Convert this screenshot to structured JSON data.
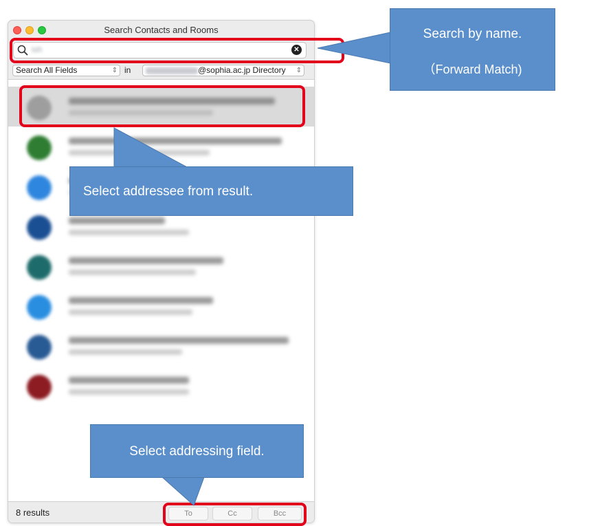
{
  "window": {
    "title": "Search Contacts and Rooms"
  },
  "search": {
    "value": "ish"
  },
  "filters": {
    "field_select": "Search All Fields",
    "in_label": "in",
    "directory_select_suffix": "@sophia.ac.jp Directory"
  },
  "results": {
    "avatar_colors": [
      "#9e9e9e",
      "#2e7d32",
      "#2e86de",
      "#1a4f93",
      "#1e6b6b",
      "#2a8ee0",
      "#285a94",
      "#8c1b22"
    ],
    "selected_index": 0
  },
  "status": {
    "count": "8 results",
    "to_label": "To",
    "cc_label": "Cc",
    "bcc_label": "Bcc"
  },
  "callouts": {
    "search_line1": "Search  by name.",
    "search_line2": "（Forward Match)",
    "select_result": "Select addressee from result.",
    "select_field": "Select addressing field."
  },
  "colors": {
    "highlight": "#e3001b",
    "callout_fill": "#5b8fcb"
  }
}
